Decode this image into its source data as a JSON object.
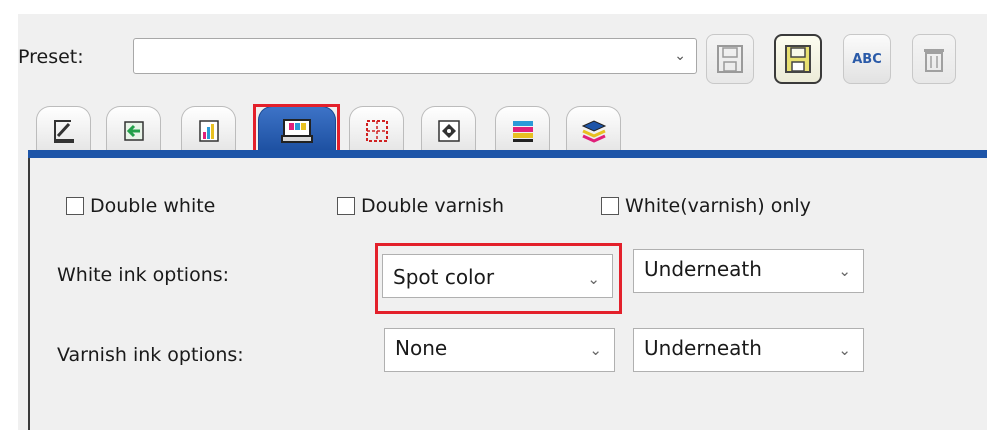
{
  "preset": {
    "label": "Preset:",
    "value": "",
    "arrow_icon": "chevron-down-icon"
  },
  "toolbar": {
    "save_icon": "floppy-disk-icon",
    "save_as_icon": "floppy-disk-active-icon",
    "rename_label": "ABC",
    "delete_icon": "trash-icon"
  },
  "tabs": [
    {
      "icon": "print-output-icon"
    },
    {
      "icon": "arrow-import-icon"
    },
    {
      "icon": "color-profile-icon"
    },
    {
      "icon": "printer-ink-icon",
      "selected": true
    },
    {
      "icon": "grid-marks-icon"
    },
    {
      "icon": "crosshair-target-icon"
    },
    {
      "icon": "color-bars-icon"
    },
    {
      "icon": "layers-stack-icon"
    }
  ],
  "checkboxes": {
    "double_white": {
      "label": "Double white",
      "checked": false
    },
    "double_varnish": {
      "label": "Double varnish",
      "checked": false
    },
    "white_only": {
      "label": "White(varnish) only",
      "checked": false
    }
  },
  "white_ink": {
    "label": "White ink options:",
    "mode": "Spot color",
    "position": "Underneath"
  },
  "varnish_ink": {
    "label": "Varnish ink options:",
    "mode": "None",
    "position": "Underneath"
  },
  "colors": {
    "tab_bar": "#1e55a8",
    "highlight": "#e3202b"
  }
}
